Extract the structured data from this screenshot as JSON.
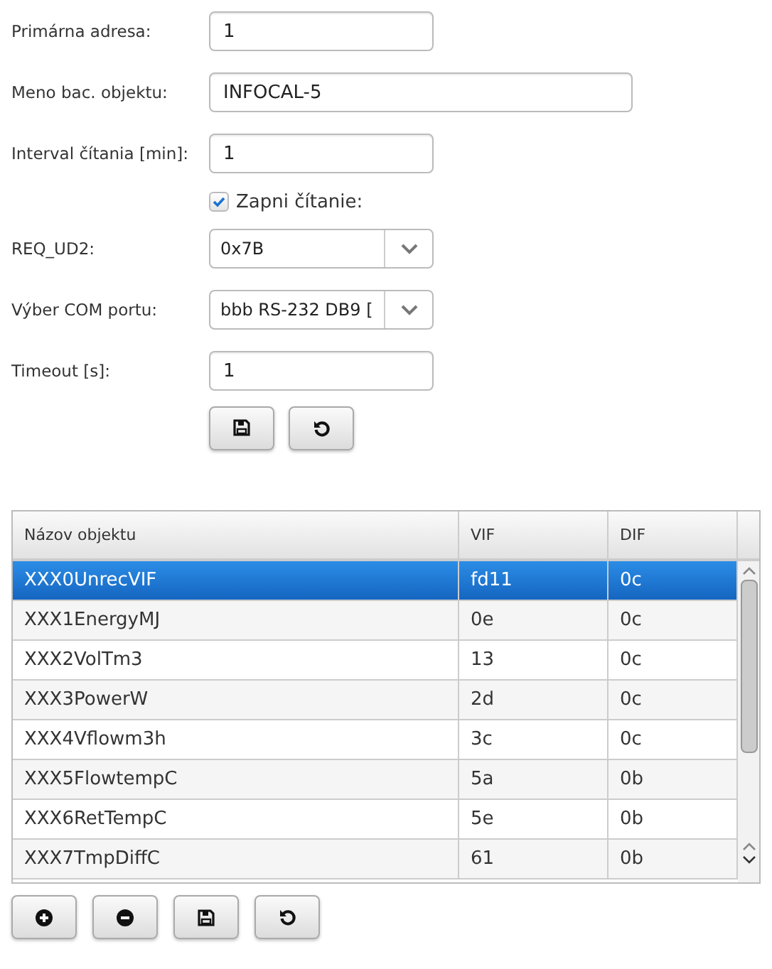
{
  "form": {
    "fields": [
      {
        "kind": "text",
        "label": "Primárna adresa:",
        "value": "1"
      },
      {
        "kind": "wide-text",
        "label": "Meno bac. objektu:",
        "value": "INFOCAL-5"
      },
      {
        "kind": "text",
        "label": "Interval čítania [min]:",
        "value": "1"
      },
      {
        "kind": "checkbox",
        "label": "Zapni čítanie:",
        "checked": true
      },
      {
        "kind": "select",
        "label": "REQ_UD2:",
        "value": "0x7B"
      },
      {
        "kind": "select",
        "label": "Výber COM portu:",
        "value": "bbb RS-232 DB9 ["
      },
      {
        "kind": "text",
        "label": "Timeout [s]:",
        "value": "1"
      }
    ],
    "buttons": [
      {
        "kind": "save"
      },
      {
        "kind": "reset"
      }
    ]
  },
  "table": {
    "columns": [
      "Názov objektu",
      "VIF",
      "DIF"
    ],
    "rows": [
      {
        "cells": [
          "XXX0UnrecVIF",
          "fd11",
          "0c"
        ],
        "selected": true
      },
      {
        "cells": [
          "XXX1EnergyMJ",
          "0e",
          "0c"
        ],
        "selected": false
      },
      {
        "cells": [
          "XXX2VolTm3",
          "13",
          "0c"
        ],
        "selected": false
      },
      {
        "cells": [
          "XXX3PowerW",
          "2d",
          "0c"
        ],
        "selected": false
      },
      {
        "cells": [
          "XXX4Vflowm3h",
          "3c",
          "0c"
        ],
        "selected": false
      },
      {
        "cells": [
          "XXX5FlowtempC",
          "5a",
          "0b"
        ],
        "selected": false
      },
      {
        "cells": [
          "XXX6RetTempC",
          "5e",
          "0b"
        ],
        "selected": false
      },
      {
        "cells": [
          "XXX7TmpDiffC",
          "61",
          "0b"
        ],
        "selected": false
      }
    ]
  },
  "table_buttons": [
    {
      "kind": "add"
    },
    {
      "kind": "remove"
    },
    {
      "kind": "save"
    },
    {
      "kind": "reset"
    }
  ]
}
